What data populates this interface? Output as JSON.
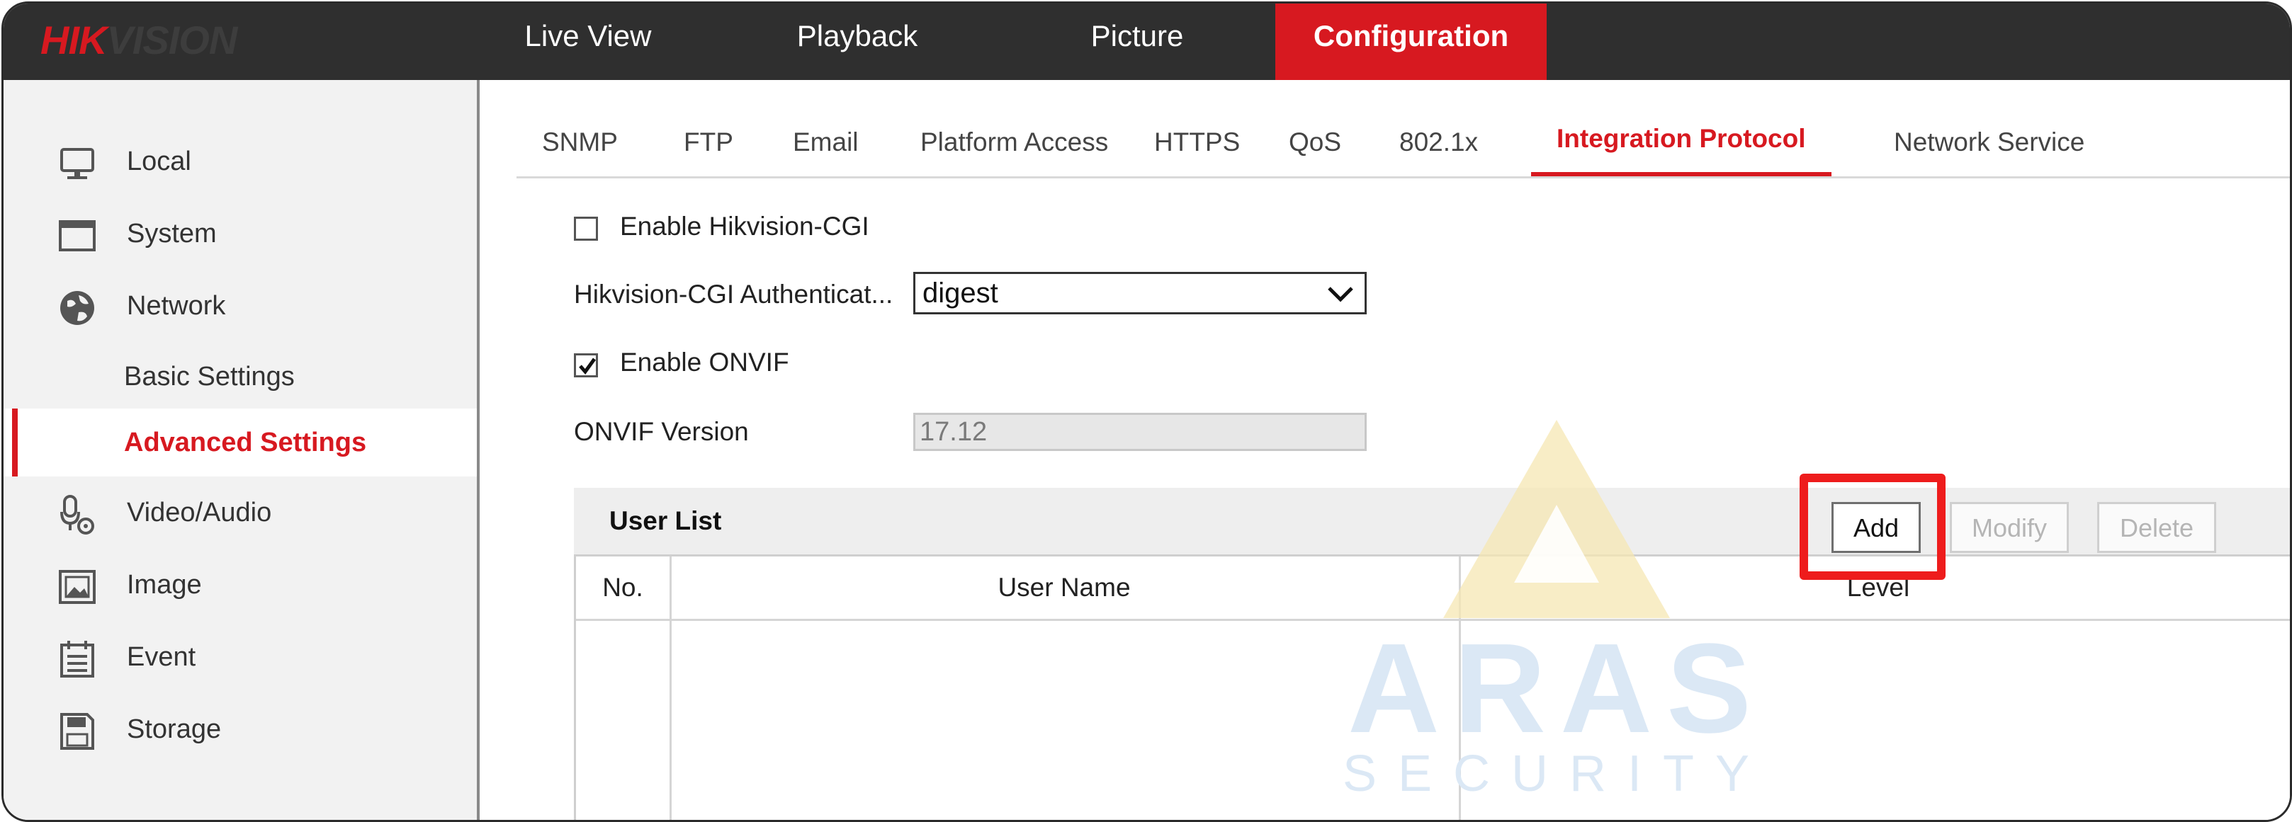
{
  "brand": {
    "part1": "HIK",
    "part2": "VISION"
  },
  "topnav": {
    "items": [
      {
        "label": "Live View"
      },
      {
        "label": "Playback"
      },
      {
        "label": "Picture"
      },
      {
        "label": "Configuration",
        "active": true
      }
    ]
  },
  "sidebar": {
    "items": [
      {
        "label": "Local",
        "icon": "monitor-icon"
      },
      {
        "label": "System",
        "icon": "window-icon"
      },
      {
        "label": "Network",
        "icon": "globe-icon"
      },
      {
        "label": "Basic Settings",
        "sub": true
      },
      {
        "label": "Advanced Settings",
        "sub": true,
        "active": true
      },
      {
        "label": "Video/Audio",
        "icon": "microphone-icon"
      },
      {
        "label": "Image",
        "icon": "image-icon"
      },
      {
        "label": "Event",
        "icon": "calendar-icon"
      },
      {
        "label": "Storage",
        "icon": "disk-icon"
      }
    ]
  },
  "tabs": [
    {
      "label": "SNMP"
    },
    {
      "label": "FTP"
    },
    {
      "label": "Email"
    },
    {
      "label": "Platform Access"
    },
    {
      "label": "HTTPS"
    },
    {
      "label": "QoS"
    },
    {
      "label": "802.1x"
    },
    {
      "label": "Integration Protocol",
      "active": true
    },
    {
      "label": "Network Service"
    }
  ],
  "form": {
    "enable_cgi_label": "Enable Hikvision-CGI",
    "enable_cgi_checked": false,
    "cgi_auth_label": "Hikvision-CGI Authenticat...",
    "cgi_auth_value": "digest",
    "enable_onvif_label": "Enable ONVIF",
    "enable_onvif_checked": true,
    "onvif_version_label": "ONVIF Version",
    "onvif_version_value": "17.12"
  },
  "user_list": {
    "title": "User List",
    "buttons": {
      "add": "Add",
      "modify": "Modify",
      "delete": "Delete"
    },
    "columns": [
      "No.",
      "User Name",
      "Level"
    ]
  },
  "watermark": {
    "word": "ARAS",
    "sub": "SECURITY"
  },
  "colors": {
    "accent": "#d71920",
    "topbar": "#2f2f2f",
    "highlight": "#ee1c1c"
  }
}
